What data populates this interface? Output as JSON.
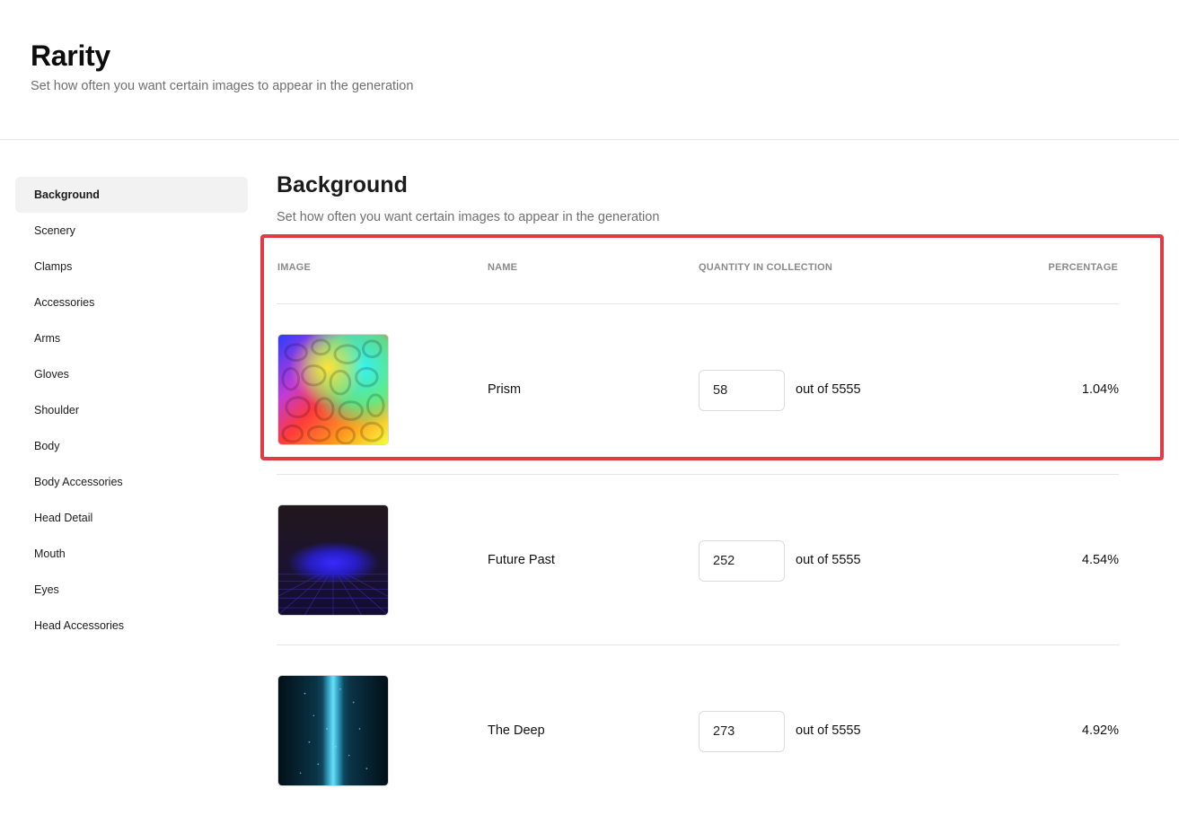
{
  "header": {
    "title": "Rarity",
    "subtitle": "Set how often you want certain images to appear in the generation"
  },
  "sidebar": {
    "items": [
      {
        "label": "Background",
        "active": true
      },
      {
        "label": "Scenery"
      },
      {
        "label": "Clamps"
      },
      {
        "label": "Accessories"
      },
      {
        "label": "Arms"
      },
      {
        "label": "Gloves"
      },
      {
        "label": "Shoulder"
      },
      {
        "label": "Body"
      },
      {
        "label": "Body Accessories"
      },
      {
        "label": "Head Detail"
      },
      {
        "label": "Mouth"
      },
      {
        "label": "Eyes"
      },
      {
        "label": "Head Accessories"
      }
    ]
  },
  "main": {
    "title": "Background",
    "subtitle": "Set how often you want certain images to appear in the generation",
    "columns": {
      "image": "IMAGE",
      "name": "NAME",
      "quantity": "QUANTITY IN COLLECTION",
      "percentage": "PERCENTAGE"
    },
    "rows": [
      {
        "name": "Prism",
        "quantity": "58",
        "out_of": "out of 5555",
        "percentage": "1.04%"
      },
      {
        "name": "Future Past",
        "quantity": "252",
        "out_of": "out of 5555",
        "percentage": "4.54%"
      },
      {
        "name": "The Deep",
        "quantity": "273",
        "out_of": "out of 5555",
        "percentage": "4.92%"
      }
    ]
  },
  "colors": {
    "highlight": "#e03a45",
    "active_bg": "#f2f2f2",
    "muted_text": "#6f6f6f"
  }
}
